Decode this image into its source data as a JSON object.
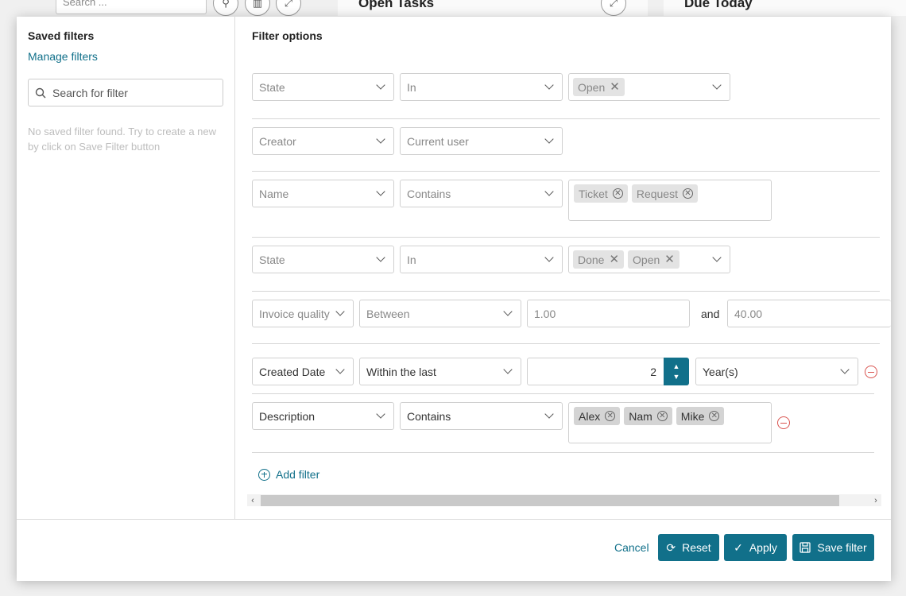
{
  "background": {
    "search_placeholder": "Search ...",
    "card_titles": [
      "Open Tasks",
      "Due Today"
    ]
  },
  "saved_filters": {
    "title": "Saved filters",
    "manage_link": "Manage filters",
    "search_placeholder": "Search for filter",
    "empty_message": "No saved filter found. Try to create a new by click on Save Filter button"
  },
  "filter_options": {
    "title": "Filter options",
    "rows": [
      {
        "field": "State",
        "operator": "In",
        "tags": [
          "Open"
        ]
      },
      {
        "field": "Creator",
        "operator": "Current user"
      },
      {
        "field": "Name",
        "operator": "Contains",
        "tags": [
          "Ticket",
          "Request"
        ]
      },
      {
        "field": "State",
        "operator": "In",
        "tags": [
          "Done",
          "Open"
        ]
      },
      {
        "field": "Invoice quality",
        "operator": "Between",
        "value_from": "1.00",
        "joiner": "and",
        "value_to": "40.00"
      },
      {
        "field": "Created Date",
        "operator": "Within the last",
        "value": "2",
        "unit": "Year(s)"
      },
      {
        "field": "Description",
        "operator": "Contains",
        "tags": [
          "Alex",
          "Nam",
          "Mike"
        ]
      }
    ],
    "add_filter_label": "Add filter"
  },
  "footer": {
    "cancel_label": "Cancel",
    "reset_label": "Reset",
    "apply_label": "Apply",
    "save_label": "Save filter"
  },
  "colors": {
    "accent": "#11708a",
    "danger": "#d9534f"
  }
}
